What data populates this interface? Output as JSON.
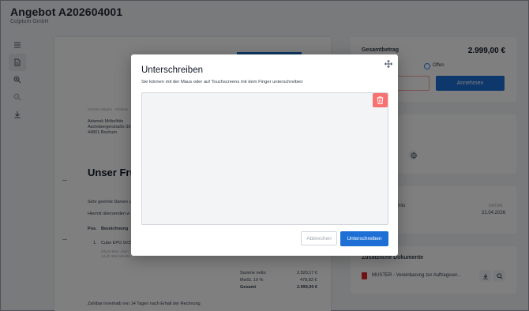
{
  "header": {
    "title": "Angebot A202604001",
    "subtitle": "Co|ptum GmbH"
  },
  "toolbar": {
    "icons": [
      "list-icon",
      "document-icon",
      "zoom-in-icon",
      "zoom-out-icon",
      "download-icon"
    ]
  },
  "document": {
    "sender_line": "Carsten Hilgers · Stahlwe",
    "recipient": {
      "name": "Adamek Möbelhits",
      "street": "Aschebergerstraße 35",
      "city": "44801 Bochum"
    },
    "heading": "Unser Früh",
    "greeting": "Sehr geehrte Damen u",
    "intro": "Hiermit übersenden w",
    "table_headers": {
      "pos": "Pos.",
      "desc": "Bezeichnung"
    },
    "item": {
      "pos": "1.",
      "name": "Cube EPO 9VZ",
      "detail1": "City E-Bike, Alum",
      "detail2": "13,4h 468 Volt-Ma"
    },
    "totals": [
      {
        "label": "Summe netto",
        "value": "2.520,17 €"
      },
      {
        "label": "MwSt. 19 %",
        "value": "478,83 €"
      },
      {
        "label": "Gesamt",
        "value": "2.999,00 €"
      }
    ],
    "footer": "Zahlbar innerhalb von 14 Tagen nach Erhalt der Rechnung"
  },
  "sidebar": {
    "total_label": "Gesamtbetrag",
    "total_value": "2.999,00 €",
    "status": "Offen",
    "accept_label": "Annehmen",
    "hits_text": "hits",
    "date_label": "DATUM",
    "date_value": "21.04.2026",
    "docs_label": "Zusätzliche Dokumente",
    "doc_name": "MUSTER - Vereinbarung zur Auftragsver...",
    "colors": {
      "accent": "#1d6fd6",
      "status": "#3b82f6"
    }
  },
  "modal": {
    "title": "Unterschreiben",
    "description": "Sie können mit der Maus oder auf Touchscreens mit dem Finger unterschreiben",
    "cancel_label": "Abbrechen",
    "sign_label": "Unterschreiben",
    "colors": {
      "primary": "#1d6fd6",
      "danger": "#f87171"
    }
  }
}
